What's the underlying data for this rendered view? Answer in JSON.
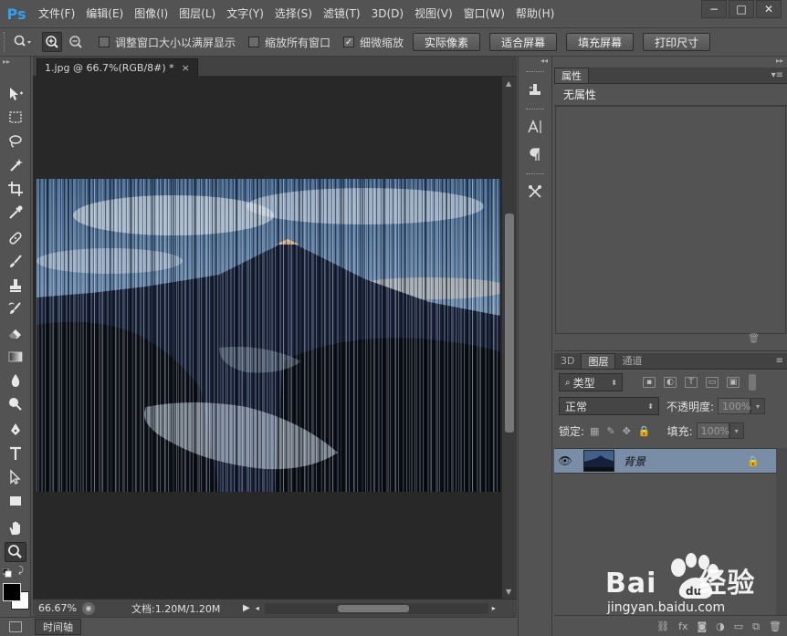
{
  "app": {
    "logo": "Ps"
  },
  "menu": [
    "文件(F)",
    "编辑(E)",
    "图像(I)",
    "图层(L)",
    "文字(Y)",
    "选择(S)",
    "滤镜(T)",
    "3D(D)",
    "视图(V)",
    "窗口(W)",
    "帮助(H)"
  ],
  "window_controls": {
    "minimize": "−",
    "maximize": "□",
    "close": "✕"
  },
  "options": {
    "resize_windows": {
      "label": "调整窗口大小以满屏显示",
      "checked": false
    },
    "zoom_all": {
      "label": "缩放所有窗口",
      "checked": false
    },
    "scrubby_zoom": {
      "label": "细微缩放",
      "checked": true
    },
    "buttons": [
      "实际像素",
      "适合屏幕",
      "填充屏幕",
      "打印尺寸"
    ]
  },
  "document": {
    "tab_title": "1.jpg @ 66.7%(RGB/8#) *",
    "tab_close": "×",
    "zoom": "66.67%",
    "doc_size": "文档:1.20M/1.20M"
  },
  "timeline": {
    "label": "时间轴"
  },
  "properties": {
    "tab": "属性",
    "content": "无属性"
  },
  "layers": {
    "tabs": [
      "3D",
      "图层",
      "通道"
    ],
    "active_tab": "图层",
    "filter_kind": "类型",
    "blend_mode": "正常",
    "opacity_label": "不透明度:",
    "opacity_value": "100%",
    "lock_label": "锁定:",
    "fill_label": "填充:",
    "fill_value": "100%",
    "items": [
      {
        "name": "背景",
        "visible": true,
        "locked": true
      }
    ],
    "bottom_icons": [
      "link-icon",
      "fx-icon",
      "mask-icon",
      "adjustment-icon",
      "group-icon",
      "new-layer-icon",
      "trash-icon"
    ],
    "bottom_fx": "fx"
  },
  "watermark": {
    "brand": "Bai",
    "brand_cn": "经验",
    "url": "jingyan.baidu.com"
  },
  "colors": {
    "ui_bg": "#535353",
    "canvas_bg": "#282828",
    "selected_layer": "#7a8da6",
    "ps_blue": "#2fa0f0"
  }
}
